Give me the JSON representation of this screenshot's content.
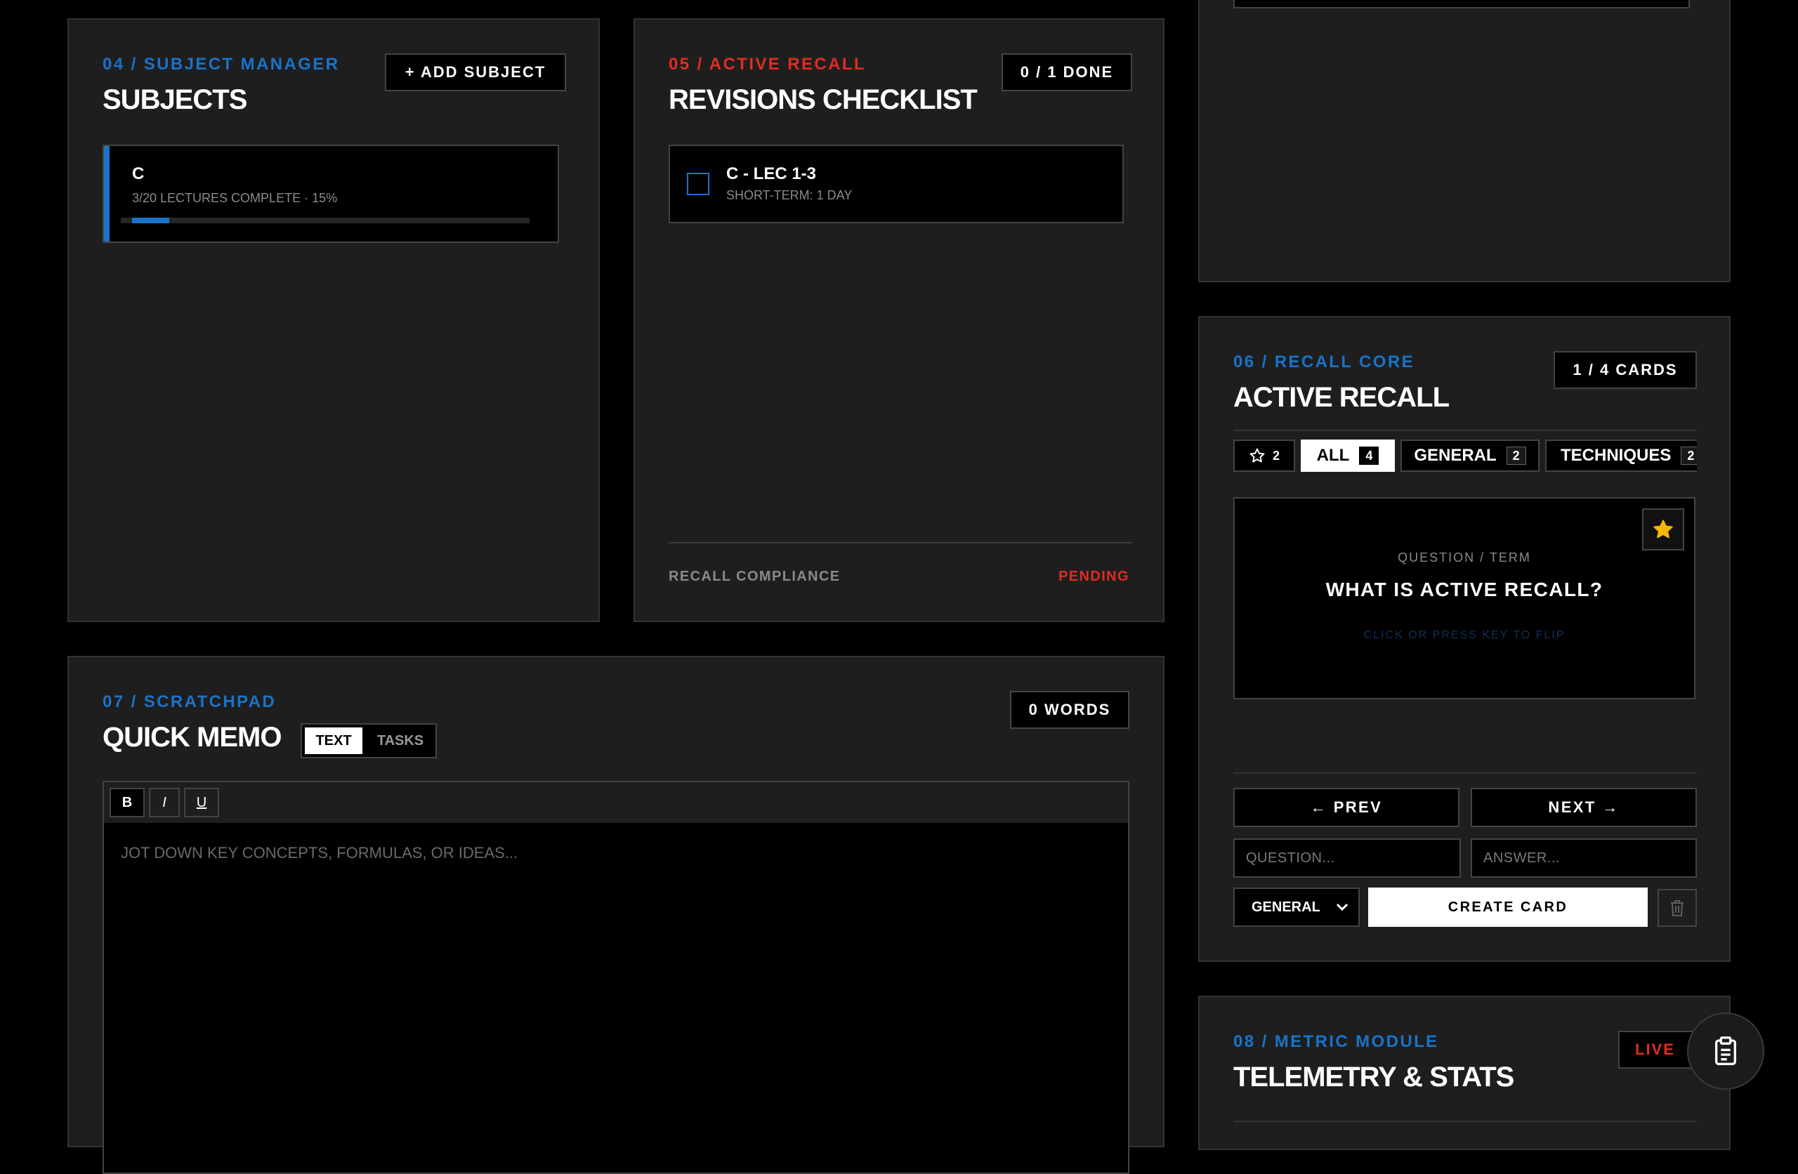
{
  "subjects_panel": {
    "kicker": "04 / SUBJECT MANAGER",
    "title": "SUBJECTS",
    "add_label": "+ ADD SUBJECT",
    "items": [
      {
        "name": "C",
        "meta": "3/20 LECTURES COMPLETE · 15%",
        "progress": 0.15
      }
    ]
  },
  "revisions_panel": {
    "kicker": "05 / ACTIVE RECALL",
    "title": "REVISIONS CHECKLIST",
    "done_badge": "0 / 1 DONE",
    "items": [
      {
        "title": "C - LEC 1-3",
        "subtitle": "SHORT-TERM: 1 DAY",
        "checked": false
      }
    ],
    "footer_label": "RECALL COMPLIANCE",
    "footer_status": "PENDING"
  },
  "recall_panel": {
    "kicker": "06 / RECALL CORE",
    "title": "ACTIVE RECALL",
    "cards_badge": "1 / 4 CARDS",
    "tabs": [
      {
        "label": "",
        "icon": "star-outline-icon",
        "count": "2"
      },
      {
        "label": "ALL",
        "count": "4",
        "active": true
      },
      {
        "label": "GENERAL",
        "count": "2"
      },
      {
        "label": "TECHNIQUES",
        "count": "2"
      }
    ],
    "card": {
      "caption": "QUESTION / TERM",
      "question": "WHAT IS ACTIVE RECALL?",
      "hint": "CLICK OR PRESS KEY TO FLIP",
      "starred": true
    },
    "prev_label": "← PREV",
    "next_label": "NEXT →",
    "question_placeholder": "QUESTION...",
    "answer_placeholder": "ANSWER...",
    "category_value": "GENERAL",
    "create_label": "CREATE CARD"
  },
  "memo_panel": {
    "kicker": "07 / SCRATCHPAD",
    "title": "QUICK MEMO",
    "mode_text": "TEXT",
    "mode_tasks": "TASKS",
    "words_badge": "0 WORDS",
    "toolbar": {
      "bold": "B",
      "italic": "I",
      "underline": "U"
    },
    "placeholder": "JOT DOWN KEY CONCEPTS, FORMULAS, OR IDEAS..."
  },
  "metrics_panel": {
    "kicker": "08 / METRIC MODULE",
    "title": "TELEMETRY & STATS",
    "live_badge": "LIVE"
  },
  "colors": {
    "accent_blue": "#1a73c8",
    "accent_red": "#e02c23",
    "star_yellow": "#f5b800"
  }
}
